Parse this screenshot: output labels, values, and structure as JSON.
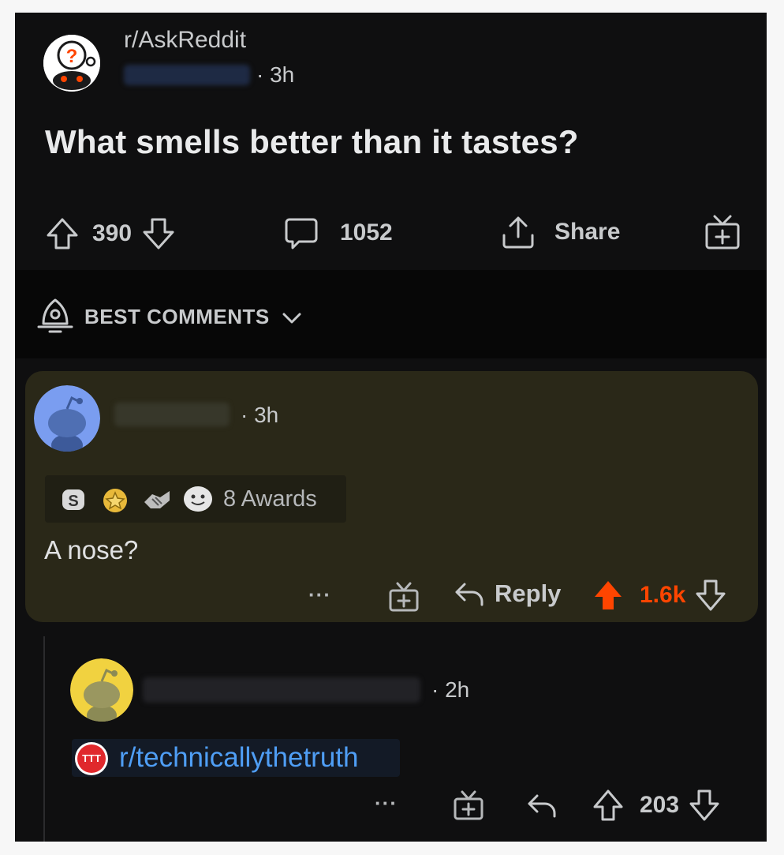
{
  "post": {
    "subreddit": "r/AskReddit",
    "time": "3h",
    "title": "What smells better than it tastes?",
    "votes": "390",
    "comments": "1052",
    "share_label": "Share"
  },
  "sort": {
    "label": "BEST COMMENTS"
  },
  "comments": [
    {
      "time": "3h",
      "awards_label": "8 Awards",
      "body": "A nose?",
      "more_label": "···",
      "reply_label": "Reply",
      "votes": "1.6k",
      "avatar_color": "#7a9df0"
    },
    {
      "time": "2h",
      "flair": "TTT",
      "body": "r/technicallythetruth",
      "more_label": "···",
      "votes": "203",
      "avatar_color": "#f1d240"
    }
  ],
  "colors": {
    "background": "#0f0f10",
    "highlight": "#2a2818",
    "upvote_active": "#ff4500",
    "link": "#4f9ef5"
  },
  "icons": [
    "snoo-question-icon",
    "upvote-icon",
    "downvote-icon",
    "comment-bubble-icon",
    "share-icon",
    "gift-icon",
    "rocket-icon",
    "chevron-down-icon",
    "reply-icon"
  ]
}
